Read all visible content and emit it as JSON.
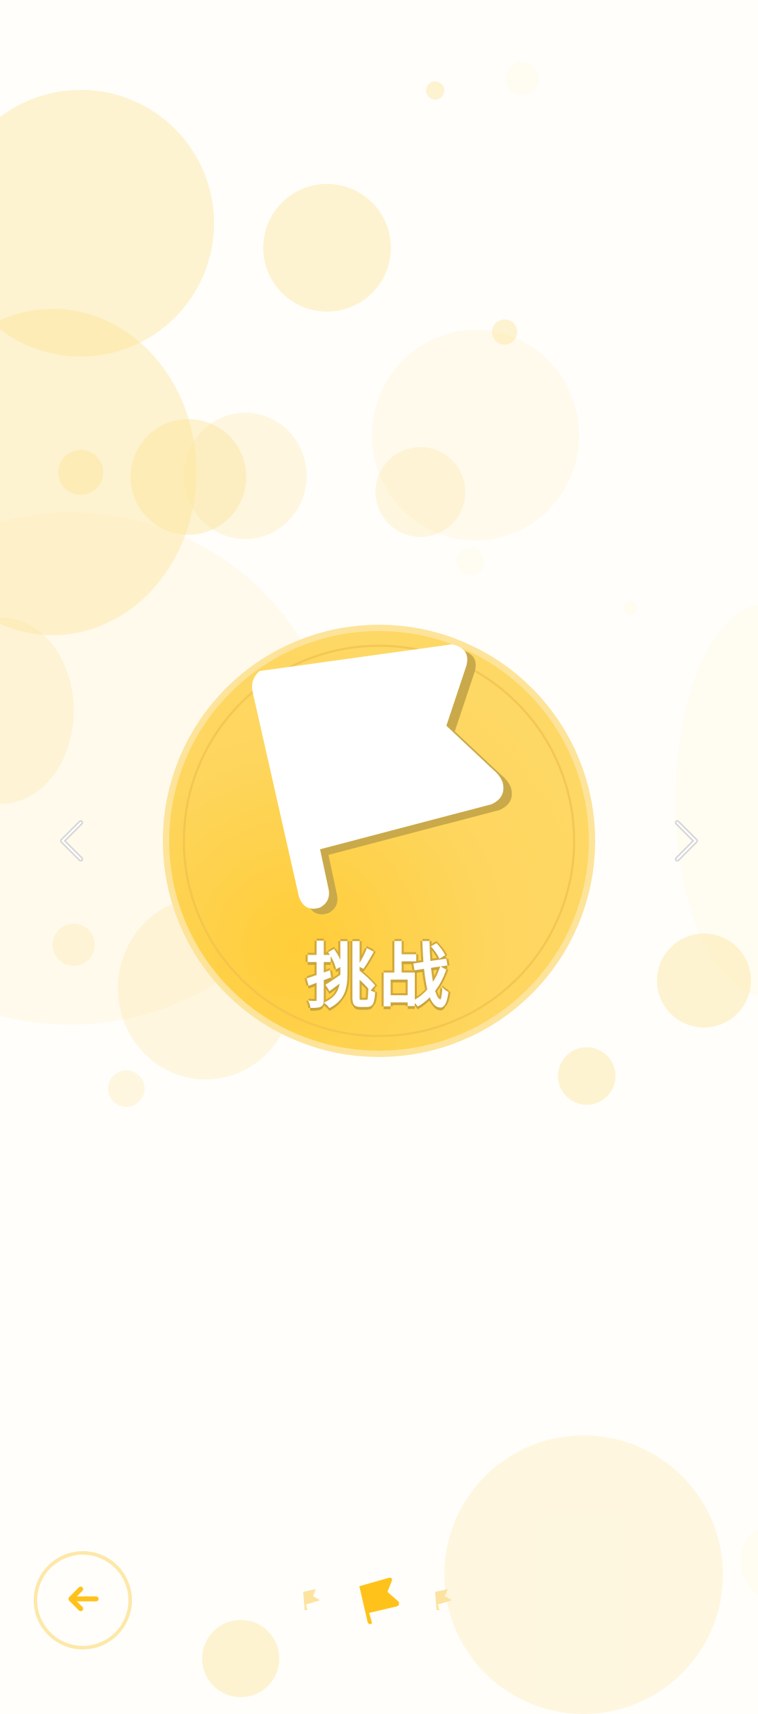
{
  "carousel": {
    "current_item": {
      "title": "挑战",
      "icon": "flag-icon"
    },
    "prev_icon": "chevron-left-icon",
    "next_icon": "chevron-right-icon"
  },
  "footer": {
    "back_icon": "arrow-left-icon",
    "page_indicator": {
      "total": 3,
      "active_index": 1,
      "icon": "flag-icon"
    }
  },
  "colors": {
    "medal_fill": "#fed65f",
    "medal_ring": "#fde49a",
    "accent": "#ffc21a",
    "bubble": "#fde6a0",
    "arrow": "#d6d6d6"
  }
}
